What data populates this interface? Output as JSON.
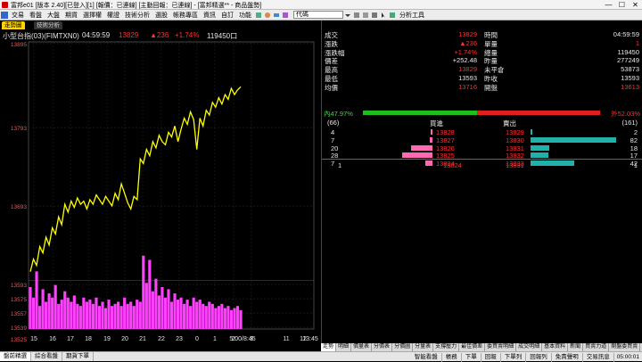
{
  "window": {
    "title": "富邦e01 [版本 2.40][已登入][1] [報價：已連線] [主動回報：已連線] - [富邦精選** - 商品盤勢]",
    "buttons": {
      "minimize": "—",
      "maximize": "☐",
      "close": "✕"
    }
  },
  "menu": {
    "items": [
      "交易",
      "看盤",
      "大盤",
      "期貨",
      "選擇權",
      "權證",
      "技術分析",
      "選股",
      "帳務專區",
      "資訊",
      "自訂",
      "功能"
    ],
    "search_value": "代碼",
    "analysis_tool": "分析工具"
  },
  "chart_tabs": {
    "main": "走勢圖",
    "tech": "技術分析"
  },
  "quote_line": {
    "symbol": "小型台指(03)(FIMTXN0)",
    "time": "04:59:59",
    "price": "13829",
    "change": "▲236",
    "change_pct": "+1.74%",
    "volume": "119450口"
  },
  "chart_data": {
    "type": "line",
    "y_ticks": [
      "13895",
      "13793",
      "13693",
      "13593",
      "13575",
      "13557",
      "13539",
      "13525"
    ],
    "x_ticks": [
      "15",
      "16",
      "17",
      "18",
      "19",
      "20",
      "21",
      "22",
      "23",
      "0",
      "1",
      "2",
      "3",
      "5:00/8:45",
      "11",
      "12",
      "13:45"
    ],
    "price_series": [
      13604,
      13620,
      13612,
      13636,
      13628,
      13648,
      13638,
      13660,
      13652,
      13674,
      13664,
      13690,
      13680,
      13694,
      13686,
      13698,
      13690,
      13694,
      13684,
      13696,
      13690,
      13702,
      13696,
      13690,
      13700,
      13694,
      13688,
      13704,
      13696,
      13716,
      13704,
      13692,
      13684,
      13700,
      13696,
      13748,
      13742,
      13760,
      13752,
      13770,
      13762,
      13778,
      13770,
      13766,
      13782,
      13776,
      13790,
      13770,
      13786,
      13800,
      13792,
      13808,
      13798,
      13760,
      13800,
      13790,
      13810,
      13804,
      13820,
      13814,
      13826,
      13818,
      13830,
      13824,
      13838,
      13830,
      13836,
      13840
    ],
    "volume_series": [
      40,
      30,
      55,
      22,
      38,
      26,
      34,
      30,
      42,
      24,
      28,
      36,
      30,
      26,
      32,
      24,
      22,
      30,
      26,
      28,
      24,
      30,
      22,
      26,
      20,
      28,
      22,
      24,
      26,
      22,
      30,
      24,
      26,
      22,
      28,
      26,
      70,
      44,
      66,
      36,
      48,
      32,
      40,
      30,
      38,
      26,
      34,
      28,
      30,
      24,
      28,
      22,
      30,
      26,
      28,
      24,
      22,
      26,
      24,
      20,
      22,
      24,
      20,
      22,
      18,
      20,
      22,
      18
    ],
    "price_range": [
      13525,
      13895
    ],
    "volume_range": [
      0,
      80
    ],
    "line_color": "#ffff00",
    "volume_color": "#ff40ff"
  },
  "stats": {
    "labels_left": [
      "成交",
      "漲跌",
      "漲跌幅",
      "價差",
      "最高",
      "最低",
      "均價"
    ],
    "values_left": [
      "13829",
      "▲236",
      "+1.74%",
      "+252.48",
      "13829",
      "13593",
      "13716"
    ],
    "labels_right": [
      "時間",
      "單量",
      "總量",
      "昨量",
      "未平倉",
      "昨收",
      "開盤"
    ],
    "values_right": [
      "04:59:59",
      "1",
      "119450",
      "277249",
      "53873",
      "13593",
      "13613"
    ]
  },
  "bar_ratio": {
    "left_pct": "47.97%",
    "right_pct": "52.03%",
    "left_label": "內",
    "right_label": "外",
    "bid_fraction": 0.4797
  },
  "orderbook": {
    "bid_total": "(66)",
    "ask_total": "(161)",
    "bid_header": "買進",
    "ask_header": "賣出",
    "rows": [
      {
        "bid_qty": "4",
        "bid_price": "13828",
        "ask_price": "13829",
        "ask_qty": "2",
        "bid_fill": 0.05,
        "ask_fill": 0.02
      },
      {
        "bid_qty": "7",
        "bid_price": "13827",
        "ask_price": "13830",
        "ask_qty": "82",
        "bid_fill": 0.09,
        "ask_fill": 1.0
      },
      {
        "bid_qty": "20",
        "bid_price": "13826",
        "ask_price": "13831",
        "ask_qty": "18",
        "bid_fill": 0.71,
        "ask_fill": 0.22
      },
      {
        "bid_qty": "28",
        "bid_price": "13825",
        "ask_price": "13832",
        "ask_qty": "17",
        "bid_fill": 1.0,
        "ask_fill": 0.21
      },
      {
        "bid_qty": "7",
        "bid_price": "13824",
        "ask_price": "13833",
        "ask_qty": "42",
        "bid_fill": 0.25,
        "ask_fill": 0.51
      }
    ],
    "summary": {
      "bid_qty": "1",
      "bid_price": "13824",
      "ask_price": "13831",
      "ask_qty": "1"
    }
  },
  "bottom_tabs": [
    "走勢",
    "明細",
    "價量表",
    "分價表",
    "分價圖",
    "分量表",
    "支撐壓力",
    "最佳價差",
    "委買賣明細",
    "成交明細",
    "基本資料",
    "新聞",
    "買賣力道",
    "開盤委買賣"
  ],
  "statusbar": {
    "left_buttons": [
      "盤前精選",
      "綜合看盤",
      "期貨下單"
    ],
    "right_buttons": [
      "智能看盤",
      "帳務",
      "下單",
      "回報",
      "下單列",
      "回報列",
      "免責聲明",
      "交易訊息"
    ],
    "clock": "05:00:01"
  }
}
